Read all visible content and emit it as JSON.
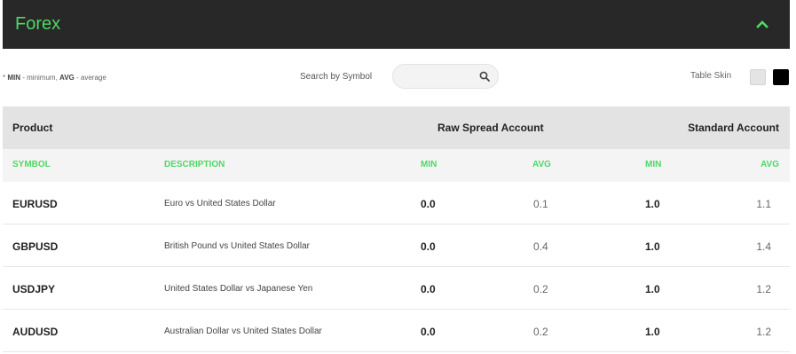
{
  "header": {
    "title": "Forex"
  },
  "note": {
    "min_abbr": "MIN",
    "min_text": " - minimum, ",
    "avg_abbr": "AVG",
    "avg_text": " - average",
    "prefix": "* "
  },
  "search": {
    "label": "Search by Symbol",
    "placeholder": "",
    "value": ""
  },
  "skin": {
    "label": "Table Skin",
    "light_color": "#e4e4e4",
    "dark_color": "#000000"
  },
  "table": {
    "group_headers": {
      "product": "Product",
      "raw": "Raw Spread Account",
      "standard": "Standard Account"
    },
    "columns": {
      "symbol": "SYMBOL",
      "description": "DESCRIPTION",
      "raw_min": "MIN",
      "raw_avg": "AVG",
      "std_min": "MIN",
      "std_avg": "AVG"
    },
    "rows": [
      {
        "symbol": "EURUSD",
        "description": "Euro vs United States Dollar",
        "raw_min": "0.0",
        "raw_avg": "0.1",
        "std_min": "1.0",
        "std_avg": "1.1"
      },
      {
        "symbol": "GBPUSD",
        "description": "British Pound vs United States Dollar",
        "raw_min": "0.0",
        "raw_avg": "0.4",
        "std_min": "1.0",
        "std_avg": "1.4"
      },
      {
        "symbol": "USDJPY",
        "description": "United States Dollar vs Japanese Yen",
        "raw_min": "0.0",
        "raw_avg": "0.2",
        "std_min": "1.0",
        "std_avg": "1.2"
      },
      {
        "symbol": "AUDUSD",
        "description": "Australian Dollar vs United States Dollar",
        "raw_min": "0.0",
        "raw_avg": "0.2",
        "std_min": "1.0",
        "std_avg": "1.2"
      }
    ]
  },
  "colors": {
    "accent": "#4cd964",
    "header_bg": "#282828"
  },
  "icons": {
    "collapse": "chevron-up-icon",
    "search": "search-icon"
  }
}
